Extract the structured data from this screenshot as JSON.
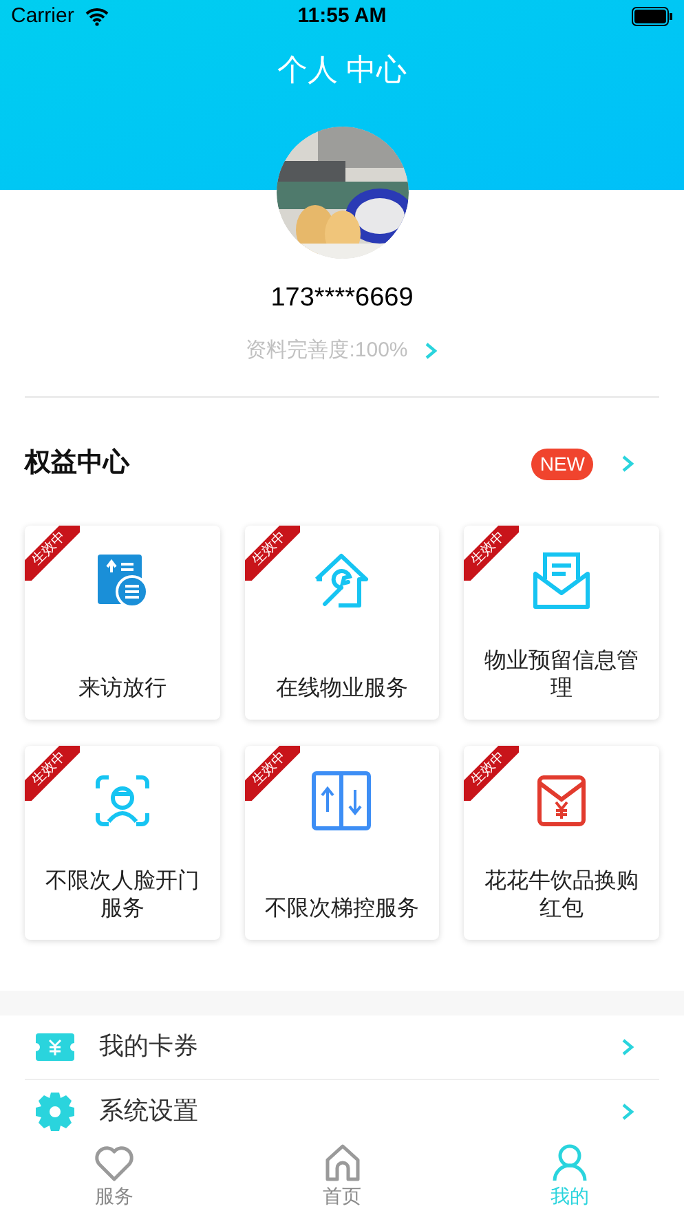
{
  "status_bar": {
    "carrier": "Carrier",
    "time": "11:55 AM"
  },
  "header": {
    "title": "个人 中心"
  },
  "profile": {
    "phone": "173****6669",
    "completeness": "资料完善度:100%"
  },
  "benefits": {
    "title": "权益中心",
    "badge": "NEW",
    "cards": [
      {
        "label": "来访放行",
        "ribbon": "生效中",
        "kind": "visitor"
      },
      {
        "label": "在线物业服务",
        "ribbon": "生效中",
        "kind": "repair"
      },
      {
        "label": "物业预留信息管理",
        "ribbon": "生效中",
        "kind": "mail"
      },
      {
        "label": "不限次人脸开门服务",
        "ribbon": "生效中",
        "kind": "face"
      },
      {
        "label": "不限次梯控服务",
        "ribbon": "生效中",
        "kind": "elevator"
      },
      {
        "label": "花花牛饮品换购红包",
        "ribbon": "生效中",
        "kind": "redpacket"
      }
    ]
  },
  "menu": [
    {
      "label": "我的卡券",
      "kind": "coupon"
    },
    {
      "label": "系统设置",
      "kind": "settings"
    }
  ],
  "tab_bar": [
    {
      "label": "服务",
      "kind": "heart",
      "selected": false
    },
    {
      "label": "首页",
      "kind": "home",
      "selected": false
    },
    {
      "label": "我的",
      "kind": "user",
      "selected": true
    }
  ]
}
